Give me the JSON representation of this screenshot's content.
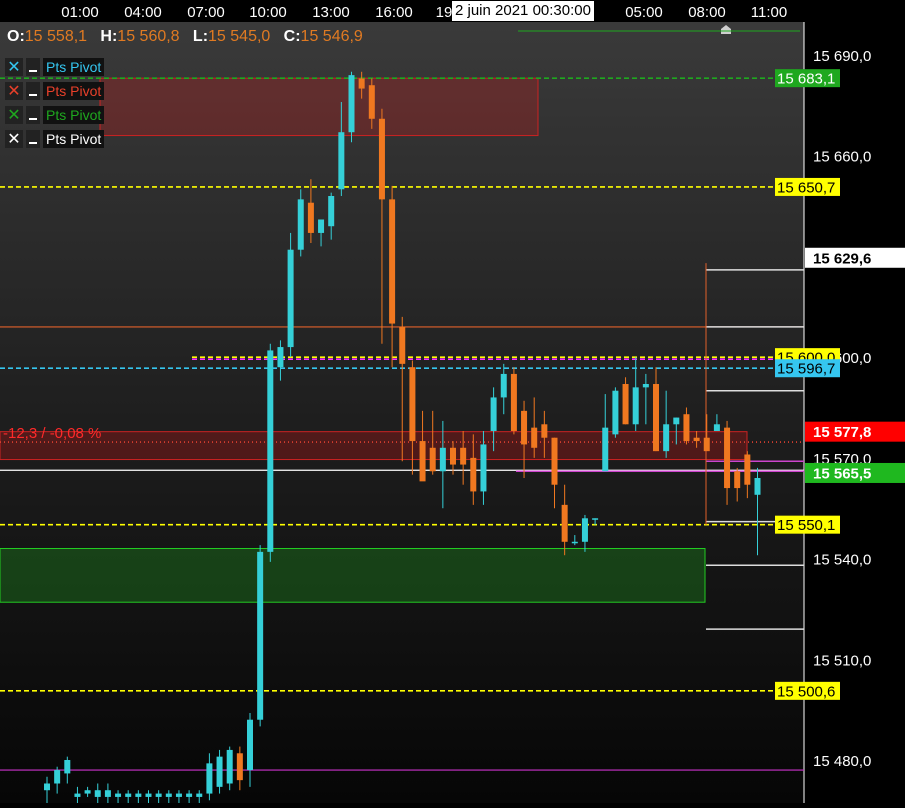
{
  "chart_data": {
    "type": "candlestick",
    "instrument_ohlc": {
      "open_label": "O:",
      "open": "15 558,1",
      "high_label": "H:",
      "high": "15 560,8",
      "low_label": "L:",
      "low": "15 545,0",
      "close_label": "C:",
      "close": "15 546,9"
    },
    "cursor_date": "2 juin 2021 00:30:00",
    "x_tick_labels": [
      "01:00",
      "04:00",
      "07:00",
      "10:00",
      "13:00",
      "16:00",
      "19",
      "05:00",
      "08:00",
      "11:00"
    ],
    "y_tick_labels": [
      "15 690,0",
      "15 660,0",
      "15 600,0",
      "15 570,0",
      "15 540,0",
      "15 510,0",
      "15 480,0"
    ],
    "ylim": [
      15467,
      15706
    ],
    "legend": [
      {
        "label": "Pts Pivot",
        "color": "#35c6f0"
      },
      {
        "label": "Pts Pivot",
        "color": "#e8402a"
      },
      {
        "label": "Pts Pivot",
        "color": "#1fa81f"
      },
      {
        "label": "Pts Pivot",
        "color": "#ffffff"
      }
    ],
    "variation_label": "-12,3 / -0,08 %",
    "price_tags": [
      {
        "text": "15 683,1",
        "value": 15683.1,
        "bg": "#1fa81f",
        "fg": "#ffffff",
        "bold": false
      },
      {
        "text": "15 650,7",
        "value": 15650.7,
        "bg": "#ffff00",
        "fg": "#000000",
        "bold": false
      },
      {
        "text": "15 629,6",
        "value": 15629.6,
        "bg": "#ffffff",
        "fg": "#000000",
        "bold": true
      },
      {
        "text": "15 600,0",
        "value": 15600.0,
        "bg": "#ffff00",
        "fg": "#000000",
        "bold": false
      },
      {
        "text": "15 596,7",
        "value": 15596.7,
        "bg": "#35c6f0",
        "fg": "#000000",
        "bold": false
      },
      {
        "text": "15 577,8",
        "value": 15577.8,
        "bg": "#ff0000",
        "fg": "#ffffff",
        "bold": true
      },
      {
        "text": "15 565,5",
        "value": 15565.5,
        "bg": "#1fb81f",
        "fg": "#ffffff",
        "bold": true
      },
      {
        "text": "15 550,1",
        "value": 15550.1,
        "bg": "#ffff00",
        "fg": "#000000",
        "bold": false
      },
      {
        "text": "15 500,6",
        "value": 15500.6,
        "bg": "#ffff00",
        "fg": "#000000",
        "bold": false
      }
    ],
    "pivot_lines": [
      {
        "value": 15683.1,
        "color": "#1fa81f",
        "style": "dashed"
      },
      {
        "value": 15650.7,
        "color": "#ffff00",
        "style": "dashed"
      },
      {
        "value": 15600.0,
        "color": "#ffff00",
        "style": "dashed"
      },
      {
        "value": 15599.4,
        "color": "#ff33ff",
        "style": "dashed"
      },
      {
        "value": 15596.7,
        "color": "#35c6f0",
        "style": "dashed"
      },
      {
        "value": 15550.1,
        "color": "#ffff00",
        "style": "dashed"
      },
      {
        "value": 15500.6,
        "color": "#ffff00",
        "style": "dashed"
      },
      {
        "value": 15609.0,
        "color": "#e0602a",
        "style": "solid"
      },
      {
        "value": 15574.7,
        "color": "#e04030",
        "style": "dotted"
      },
      {
        "value": 15566.3,
        "color": "#ffffff",
        "style": "solid"
      },
      {
        "value": 15477.0,
        "color": "#cc33cc",
        "style": "solid"
      }
    ],
    "candles": [
      {
        "o": 15471,
        "h": 15475,
        "l": 15467,
        "c": 15473
      },
      {
        "o": 15473,
        "h": 15478,
        "l": 15470,
        "c": 15477
      },
      {
        "o": 15476,
        "h": 15481,
        "l": 15473,
        "c": 15480
      },
      {
        "o": 15469,
        "h": 15472,
        "l": 15467,
        "c": 15470
      },
      {
        "o": 15470,
        "h": 15472,
        "l": 15469,
        "c": 15471
      },
      {
        "o": 15469,
        "h": 15473,
        "l": 15466,
        "c": 15471
      },
      {
        "o": 15469,
        "h": 15473,
        "l": 15467,
        "c": 15471
      },
      {
        "o": 15469,
        "h": 15471,
        "l": 15467,
        "c": 15470
      },
      {
        "o": 15469,
        "h": 15471,
        "l": 15467,
        "c": 15470
      },
      {
        "o": 15469,
        "h": 15471,
        "l": 15467,
        "c": 15470
      },
      {
        "o": 15469,
        "h": 15471,
        "l": 15467,
        "c": 15470
      },
      {
        "o": 15469,
        "h": 15471,
        "l": 15467,
        "c": 15470
      },
      {
        "o": 15469,
        "h": 15471,
        "l": 15467,
        "c": 15470
      },
      {
        "o": 15469,
        "h": 15471,
        "l": 15467,
        "c": 15470
      },
      {
        "o": 15469,
        "h": 15471,
        "l": 15467,
        "c": 15470
      },
      {
        "o": 15469,
        "h": 15471,
        "l": 15467,
        "c": 15470
      },
      {
        "o": 15470,
        "h": 15482,
        "l": 15468,
        "c": 15479
      },
      {
        "o": 15472,
        "h": 15483,
        "l": 15470,
        "c": 15481
      },
      {
        "o": 15473,
        "h": 15484,
        "l": 15471,
        "c": 15483
      },
      {
        "o": 15482,
        "h": 15484,
        "l": 15471,
        "c": 15474
      },
      {
        "o": 15477,
        "h": 15494,
        "l": 15472,
        "c": 15492
      },
      {
        "o": 15492,
        "h": 15544,
        "l": 15490,
        "c": 15542
      },
      {
        "o": 15542,
        "h": 15604,
        "l": 15539,
        "c": 15602
      },
      {
        "o": 15597,
        "h": 15605,
        "l": 15593,
        "c": 15603
      },
      {
        "o": 15603,
        "h": 15637,
        "l": 15600,
        "c": 15632
      },
      {
        "o": 15632,
        "h": 15650,
        "l": 15630,
        "c": 15647
      },
      {
        "o": 15646,
        "h": 15653,
        "l": 15634,
        "c": 15637
      },
      {
        "o": 15637,
        "h": 15641,
        "l": 15633,
        "c": 15641
      },
      {
        "o": 15639,
        "h": 15649,
        "l": 15635,
        "c": 15648
      },
      {
        "o": 15650,
        "h": 15676,
        "l": 15648,
        "c": 15667
      },
      {
        "o": 15667,
        "h": 15685,
        "l": 15664,
        "c": 15684
      },
      {
        "o": 15683,
        "h": 15685,
        "l": 15677,
        "c": 15680
      },
      {
        "o": 15681,
        "h": 15683,
        "l": 15668,
        "c": 15671
      },
      {
        "o": 15671,
        "h": 15674,
        "l": 15604,
        "c": 15647
      },
      {
        "o": 15647,
        "h": 15651,
        "l": 15597,
        "c": 15610
      },
      {
        "o": 15609,
        "h": 15612,
        "l": 15569,
        "c": 15598
      },
      {
        "o": 15597,
        "h": 15599,
        "l": 15565,
        "c": 15575
      },
      {
        "o": 15575,
        "h": 15584,
        "l": 15565,
        "c": 15563
      },
      {
        "o": 15573,
        "h": 15584,
        "l": 15565,
        "c": 15566
      },
      {
        "o": 15566,
        "h": 15581,
        "l": 15555,
        "c": 15573
      },
      {
        "o": 15573,
        "h": 15575,
        "l": 15565,
        "c": 15568
      },
      {
        "o": 15573,
        "h": 15578,
        "l": 15562,
        "c": 15568
      },
      {
        "o": 15570,
        "h": 15577,
        "l": 15556,
        "c": 15560
      },
      {
        "o": 15560,
        "h": 15578,
        "l": 15556,
        "c": 15574
      },
      {
        "o": 15578,
        "h": 15591,
        "l": 15572,
        "c": 15588
      },
      {
        "o": 15588,
        "h": 15598,
        "l": 15583,
        "c": 15595
      },
      {
        "o": 15595,
        "h": 15597,
        "l": 15577,
        "c": 15578
      },
      {
        "o": 15584,
        "h": 15587,
        "l": 15564,
        "c": 15574
      },
      {
        "o": 15579,
        "h": 15588,
        "l": 15570,
        "c": 15573
      },
      {
        "o": 15580,
        "h": 15584,
        "l": 15570,
        "c": 15576
      },
      {
        "o": 15576,
        "h": 15576,
        "l": 15555,
        "c": 15562
      },
      {
        "o": 15556,
        "h": 15562,
        "l": 15541,
        "c": 15545
      },
      {
        "o": 15545,
        "h": 15547,
        "l": 15544,
        "c": 15545
      },
      {
        "o": 15545,
        "h": 15553,
        "l": 15542,
        "c": 15552
      },
      {
        "o": 15552,
        "h": 15552,
        "l": 15550,
        "c": 15552
      },
      {
        "o": 15566,
        "h": 15589,
        "l": 15566,
        "c": 15579
      },
      {
        "o": 15577,
        "h": 15591,
        "l": 15576,
        "c": 15590
      },
      {
        "o": 15592,
        "h": 15594,
        "l": 15580,
        "c": 15580
      },
      {
        "o": 15580,
        "h": 15600,
        "l": 15578,
        "c": 15591
      },
      {
        "o": 15591,
        "h": 15595,
        "l": 15580,
        "c": 15592
      },
      {
        "o": 15592,
        "h": 15597,
        "l": 15572,
        "c": 15572
      },
      {
        "o": 15572,
        "h": 15590,
        "l": 15570,
        "c": 15580
      },
      {
        "o": 15580,
        "h": 15582,
        "l": 15574,
        "c": 15582
      },
      {
        "o": 15583,
        "h": 15585,
        "l": 15574,
        "c": 15575
      },
      {
        "o": 15576,
        "h": 15578,
        "l": 15573,
        "c": 15575
      },
      {
        "o": 15576,
        "h": 15583,
        "l": 15573,
        "c": 15572
      },
      {
        "o": 15578,
        "h": 15583,
        "l": 15578,
        "c": 15580
      },
      {
        "o": 15579,
        "h": 15581,
        "l": 15556,
        "c": 15561
      },
      {
        "o": 15566,
        "h": 15567,
        "l": 15557,
        "c": 15561
      },
      {
        "o": 15571,
        "h": 15572,
        "l": 15558,
        "c": 15562
      },
      {
        "o": 15559,
        "h": 15567,
        "l": 15541,
        "c": 15564
      }
    ]
  }
}
